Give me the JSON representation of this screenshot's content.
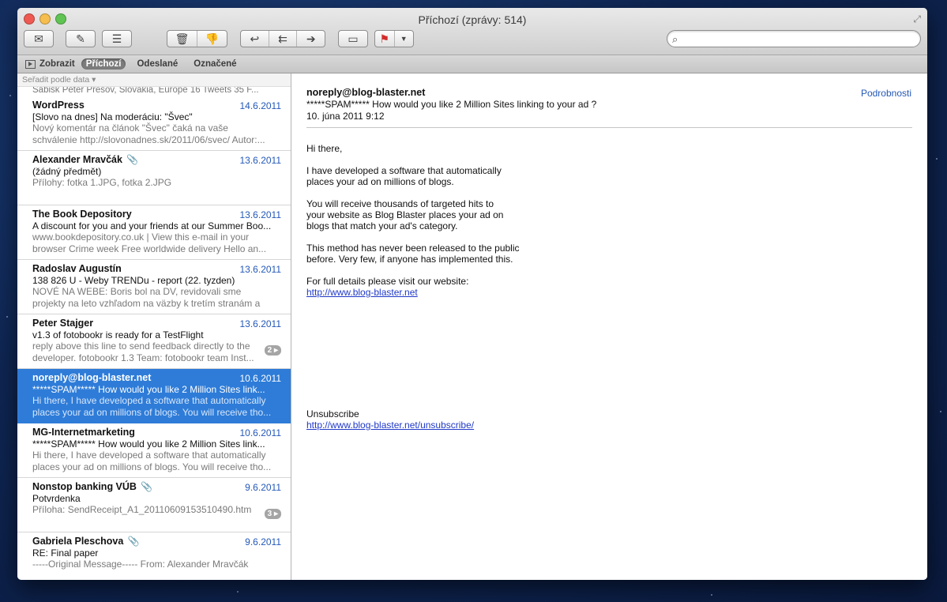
{
  "window": {
    "title": "Příchozí (zprávy: 514)"
  },
  "toolbar": {
    "icons": [
      "get-mail-icon",
      "compose-icon",
      "note-icon",
      "trash-icon",
      "junk-icon",
      "reply-icon",
      "reply-all-icon",
      "forward-icon",
      "archive-icon",
      "flag-icon"
    ],
    "search_placeholder": ""
  },
  "favorites": {
    "show": "Zobrazit",
    "items": [
      {
        "label": "Příchozí",
        "active": true
      },
      {
        "label": "Odeslané",
        "active": false
      },
      {
        "label": "Označené",
        "active": false
      }
    ]
  },
  "list": {
    "sort_label": "Seřadit podle data ▾",
    "clipped_top": "Sabisk Peter Presov, Slovakia, Europe 16 Tweets 35 F...",
    "messages": [
      {
        "from": "WordPress",
        "date": "14.6.2011",
        "subject": "[Slovo na dnes] Na moderáciu: \"Švec\"",
        "preview": "Nový komentár na článok \"Švec\" čaká na vaše schválenie http://slovonadnes.sk/2011/06/svec/ Autor:...",
        "attachment": false,
        "thread": ""
      },
      {
        "from": "Alexander Mravčák",
        "date": "13.6.2011",
        "subject": "(žádný předmět)",
        "preview": "Přílohy: fotka 1.JPG, fotka 2.JPG",
        "attachment": true,
        "thread": ""
      },
      {
        "from": "The Book Depository",
        "date": "13.6.2011",
        "subject": "A discount for you and your friends at our Summer Boo...",
        "preview": "www.bookdepository.co.uk | View this e-mail in your browser Crime week Free worldwide delivery Hello an...",
        "attachment": false,
        "thread": ""
      },
      {
        "from": "Radoslav Augustín",
        "date": "13.6.2011",
        "subject": "138 826 U - Weby TRENDu - report (22. tyzden)",
        "preview": "NOVÉ NA WEBE: Boris bol na DV, revidovali sme projekty na leto vzhľadom na väzby k tretím stranám a n...",
        "attachment": false,
        "thread": ""
      },
      {
        "from": "Peter Stajger",
        "date": "13.6.2011",
        "subject": "v1.3 of fotobookr is ready for a TestFlight",
        "preview": "reply above this line to send feedback directly to the developer. fotobookr 1.3 Team: fotobookr team Inst...",
        "attachment": false,
        "thread": "2 ▸"
      },
      {
        "from": "noreply@blog-blaster.net",
        "date": "10.6.2011",
        "subject": "*****SPAM***** How would you like 2 Million Sites link...",
        "preview": "Hi there, I have developed a software that automatically places your ad on millions of blogs. You will receive tho...",
        "attachment": false,
        "thread": "",
        "selected": true
      },
      {
        "from": "MG-Internetmarketing",
        "date": "10.6.2011",
        "subject": "*****SPAM***** How would you like 2 Million Sites link...",
        "preview": "Hi there, I have developed a software that automatically places your ad on millions of blogs. You will receive tho...",
        "attachment": false,
        "thread": ""
      },
      {
        "from": "Nonstop banking VÚB",
        "date": "9.6.2011",
        "subject": "Potvrdenka",
        "preview": "Příloha: SendReceipt_A1_20110609153510490.htm",
        "attachment": true,
        "thread": "3 ▸"
      },
      {
        "from": "Gabriela Pleschova",
        "date": "9.6.2011",
        "subject": "RE: Final paper",
        "preview": "-----Original Message----- From: Alexander Mravčák",
        "attachment": true,
        "thread": ""
      }
    ]
  },
  "reader": {
    "from": "noreply@blog-blaster.net",
    "subject": "*****SPAM***** How would you like 2 Million Sites linking to your ad ?",
    "date": "10. júna 2011 9:12",
    "details_link": "Podrobnosti",
    "body": {
      "p1": "Hi there,",
      "p2": "I have developed a software that automatically\nplaces your ad on millions of blogs.",
      "p3": "You will receive thousands of targeted hits to\nyour website as Blog Blaster places your ad on\nblogs that match your ad's category.",
      "p4": "This method has never been released to the public\nbefore. Very few, if anyone has implemented this.",
      "p5": "For full details please visit our website:",
      "link": "http://www.blog-blaster.net"
    },
    "unsubscribe_label": "Unsubscribe",
    "unsubscribe_link": "http://www.blog-blaster.net/unsubscribe/"
  }
}
